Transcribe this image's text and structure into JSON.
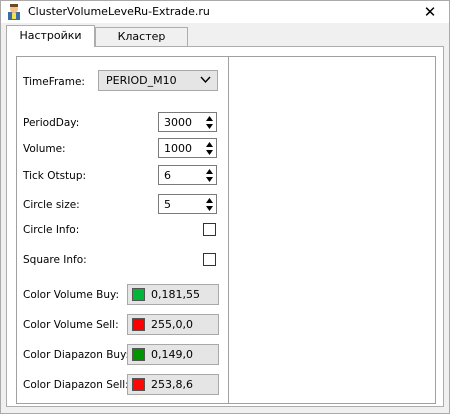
{
  "window": {
    "title": "ClusterVolumeLevel",
    "site": "Ru-Extrade.ru",
    "close_glyph": "✕"
  },
  "tabs": [
    {
      "label": "Настройки",
      "active": true
    },
    {
      "label": "Кластер",
      "active": false
    }
  ],
  "settings": {
    "timeframe": {
      "label": "TimeFrame:",
      "value": "PERIOD_M10"
    },
    "period_day": {
      "label": "PeriodDay:",
      "value": "3000"
    },
    "volume": {
      "label": "Volume:",
      "value": "1000"
    },
    "tick_otstup": {
      "label": "Tick Otstup:",
      "value": "6"
    },
    "circle_size": {
      "label": "Circle size:",
      "value": "5"
    },
    "circle_info": {
      "label": "Circle Info:",
      "checked": false
    },
    "square_info": {
      "label": "Square Info:",
      "checked": false
    },
    "color_volume_buy": {
      "label": "Color Volume Buy:",
      "value": "0,181,55",
      "color": "#00b537"
    },
    "color_volume_sell": {
      "label": "Color Volume Sell:",
      "value": "255,0,0",
      "color": "#ff0000"
    },
    "color_diapazon_buy": {
      "label": "Color Diapazon Buy:",
      "value": "0,149,0",
      "color": "#009500"
    },
    "color_diapazon_sell": {
      "label": "Color Diapazon Sell:",
      "value": "253,8,6",
      "color": "#fd0806"
    }
  },
  "icons": {
    "app": "trader-icon",
    "close": "close-icon",
    "dropdown": "chevron-down-icon",
    "spin_up": "spin-up-icon",
    "spin_down": "spin-down-icon"
  }
}
